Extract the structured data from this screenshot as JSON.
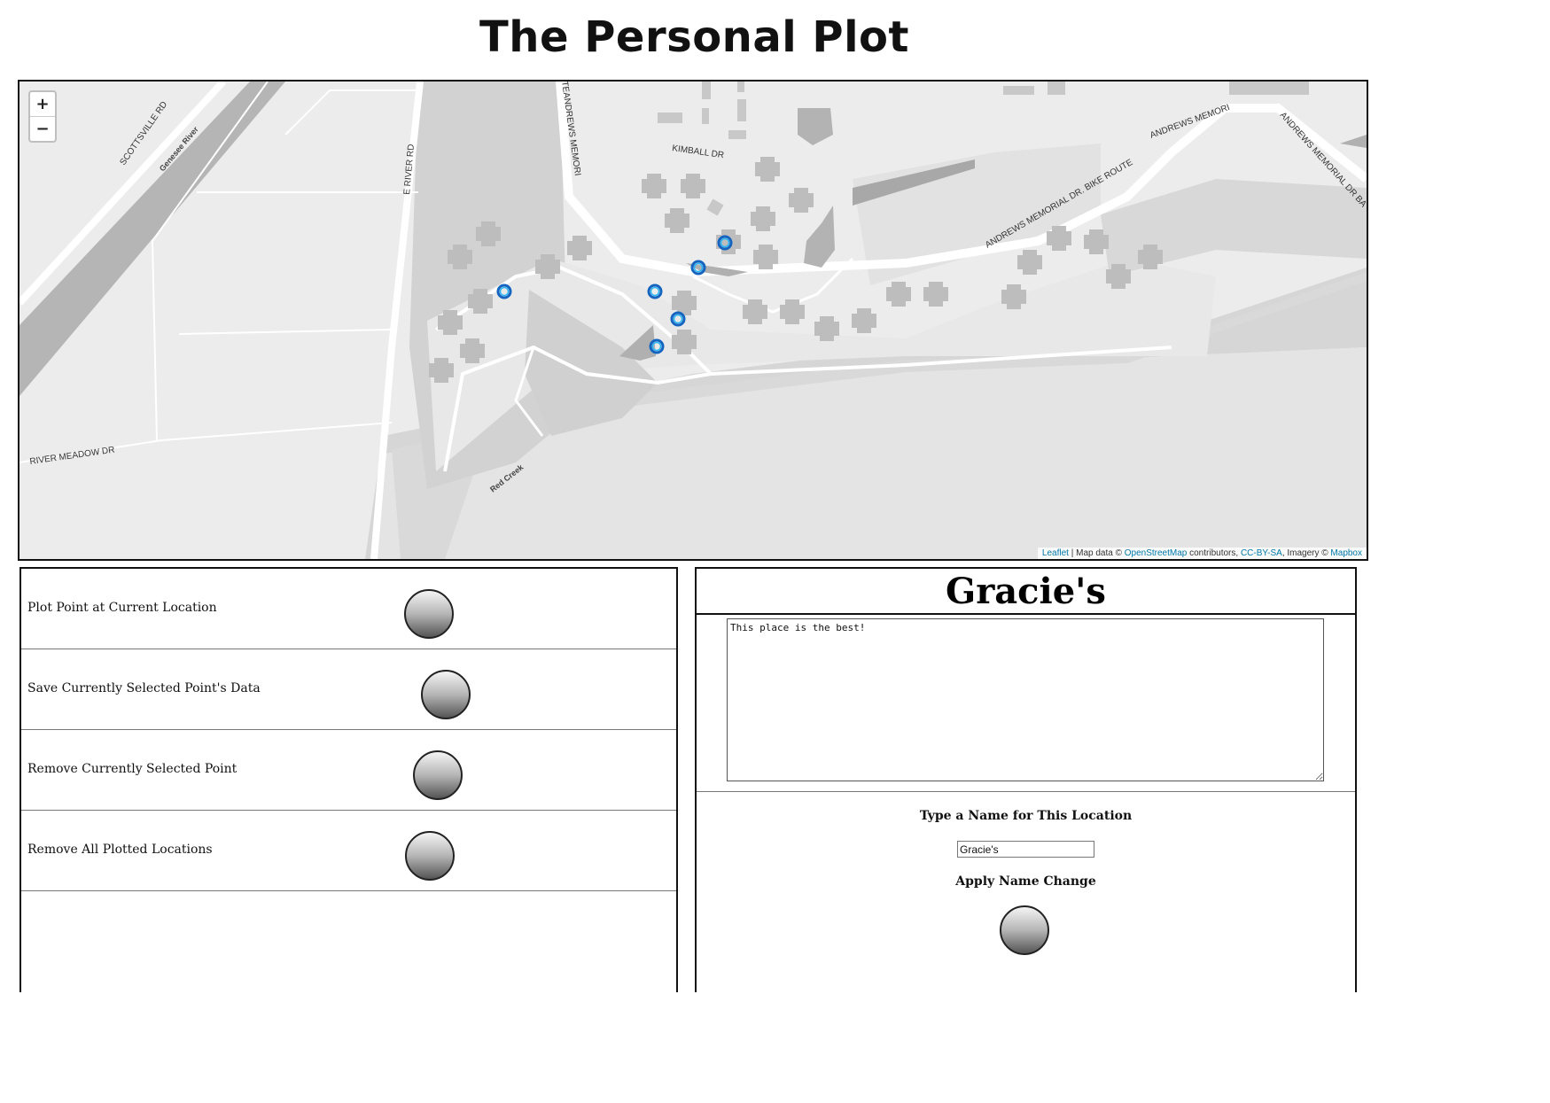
{
  "page": {
    "title": "The Personal Plot"
  },
  "map": {
    "zoom_in": "+",
    "zoom_out": "−",
    "labels": {
      "scottsville": "SCOTTSVILLE RD",
      "genesee": "Genesee River",
      "eriver": "E RIVER RD",
      "andrews_vert": "TEANDREWS MEMORI",
      "kimball": "KIMBALL DR",
      "bike_route": "ANDREWS MEMORIAL DR. BIKE ROUTE",
      "andrews_top": "ANDREWS MEMORI",
      "andrews_right": "ANDREWS MEMORIAL DR BA",
      "river_meadow": "RIVER MEADOW DR",
      "red_creek": "Red Creek"
    },
    "attribution": {
      "leaflet": "Leaflet",
      "sep1": " | Map data © ",
      "osm": "OpenStreetMap",
      "sep2": " contributors, ",
      "license": "CC-BY-SA",
      "sep3": ", Imagery © ",
      "mapbox": "Mapbox"
    },
    "marker_colors": {
      "ring": "#1565c0",
      "inner": "#29b6f6"
    }
  },
  "controls": {
    "plot_point": "Plot Point at Current Location",
    "save_point": "Save Currently Selected Point's Data",
    "remove_point": "Remove Currently Selected Point",
    "remove_all": "Remove All Plotted Locations"
  },
  "detail": {
    "name": "Gracie's",
    "notes": "This place is the best!",
    "name_prompt": "Type a Name for This Location",
    "name_value": "Gracie's",
    "apply_label": "Apply Name Change"
  }
}
